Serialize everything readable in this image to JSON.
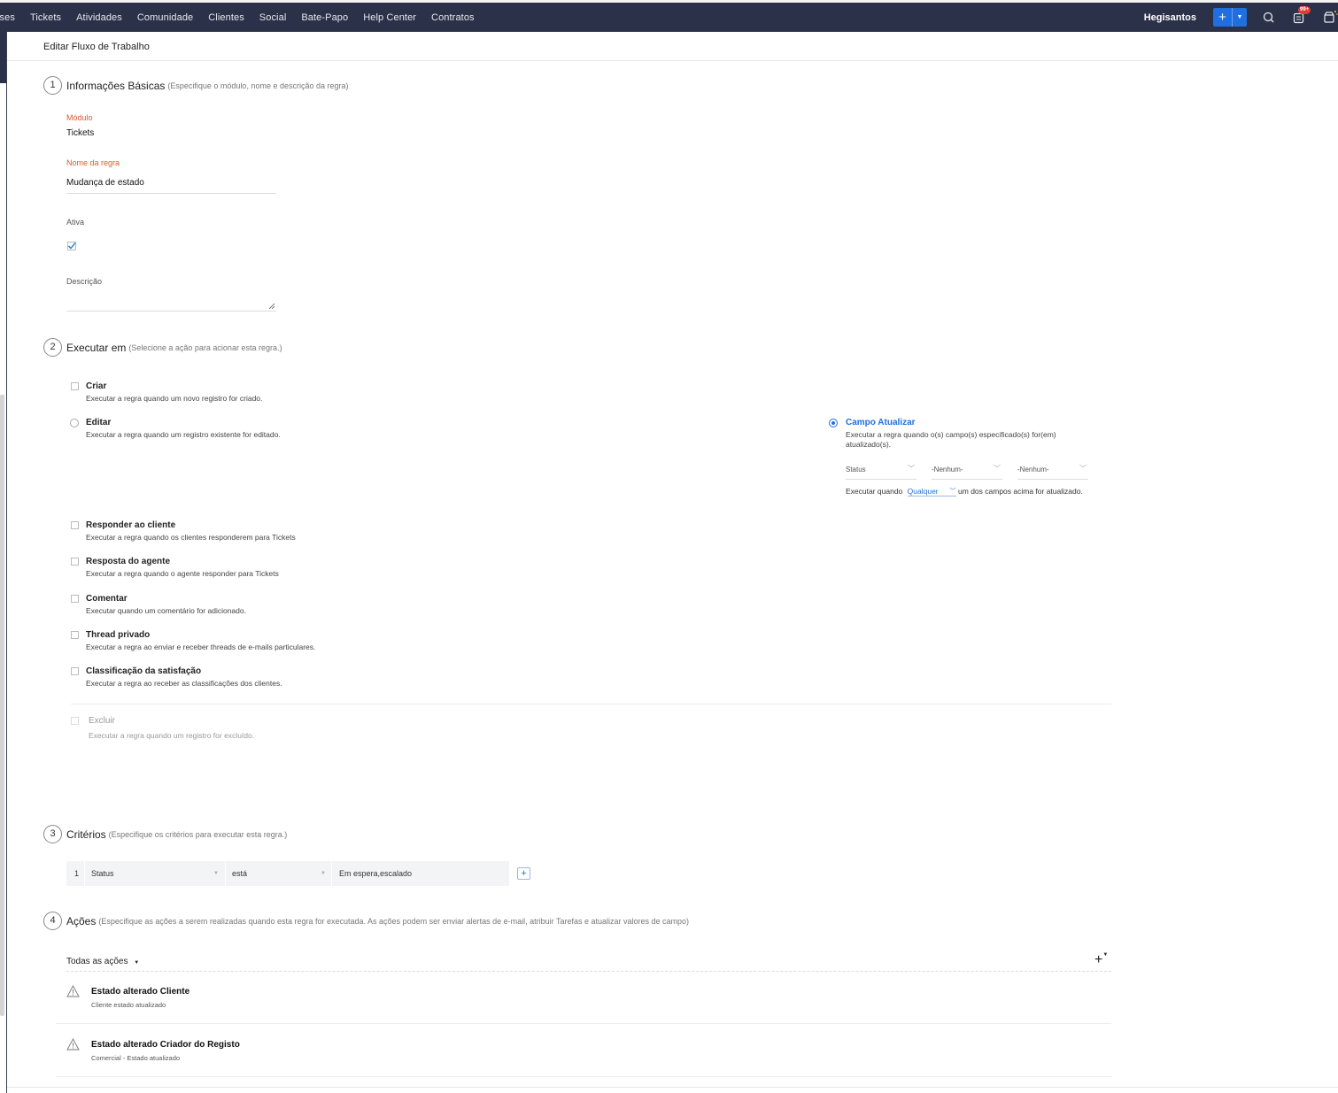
{
  "topbar": {
    "nav": [
      "ises",
      "Tickets",
      "Atividades",
      "Comunidade",
      "Clientes",
      "Social",
      "Bate-Papo",
      "Help Center",
      "Contratos"
    ],
    "user": "Hegisantos",
    "add_label": "+",
    "notification_badge": "99+",
    "icons": [
      "search-icon",
      "notifications-icon",
      "marketplace-icon"
    ]
  },
  "page": {
    "title": "Editar Fluxo de Trabalho"
  },
  "section1": {
    "num": "1",
    "title": "Informações Básicas",
    "subtitle": "(Especifique o módulo, nome e descrição da regra)",
    "module_label": "Módulo",
    "module_value": "Tickets",
    "rule_name_label": "Nome da regra",
    "rule_name_value": "Mudança de estado",
    "active_label": "Ativa",
    "active_checked": true,
    "description_label": "Descrição"
  },
  "section2": {
    "num": "2",
    "title": "Executar em",
    "subtitle": "(Selecione a ação para acionar esta regra.)",
    "options": [
      {
        "title": "Criar",
        "desc": "Executar a regra quando um novo registro for criado."
      },
      {
        "title": "Editar",
        "desc": "Executar a regra quando um registro existente for editado."
      },
      {
        "title": "Responder ao cliente",
        "desc": "Executar a regra quando os clientes responderem para Tickets"
      },
      {
        "title": "Resposta do agente",
        "desc": "Executar a regra quando o agente responder para Tickets"
      },
      {
        "title": "Comentar",
        "desc": "Executar quando um comentário for adicionado."
      },
      {
        "title": "Thread privado",
        "desc": "Executar a regra ao enviar e receber threads de e-mails particulares."
      },
      {
        "title": "Classificação da satisfação",
        "desc": "Executar a regra ao receber as classificações dos clientes."
      },
      {
        "title": "Excluir",
        "desc": "Executar a regra quando um registro for excluído."
      }
    ],
    "field_update": {
      "title": "Campo Atualizar",
      "desc": "Executar a regra quando o(s) campo(s) especificado(s) for(em) atualizado(s).",
      "fields": [
        "Status",
        "-Nenhum-",
        "-Nenhum-"
      ],
      "execute_prefix": "Executar quando",
      "execute_choice": "Qualquer",
      "execute_suffix": "um dos campos acima for atualizado."
    }
  },
  "section3": {
    "num": "3",
    "title": "Critérios",
    "subtitle": "(Especifique os critérios para executar esta regra.)",
    "criteria": [
      {
        "index": "1",
        "field": "Status",
        "operator": "está",
        "value": "Em espera,escalado"
      }
    ],
    "add_label": "+"
  },
  "section4": {
    "num": "4",
    "title": "Ações",
    "subtitle": "(Especifique as ações a serem realizadas quando esta regra for executada. As ações podem ser enviar alertas de e-mail, atribuir Tarefas e atualizar valores de campo)",
    "filter_label": "Todas as ações",
    "add_label": "+",
    "actions": [
      {
        "title": "Estado alterado Cliente",
        "desc": "Cliente estado atualizado"
      },
      {
        "title": "Estado alterado Criador do Registo",
        "desc": "Comercial - Estado atualizado"
      }
    ]
  }
}
